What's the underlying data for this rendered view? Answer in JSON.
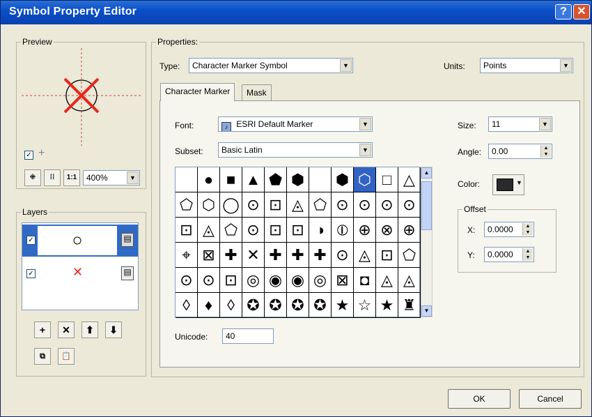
{
  "window": {
    "title": "Symbol Property Editor",
    "help_icon": "question-icon",
    "close_icon": "close-icon"
  },
  "preview": {
    "legend": "Preview",
    "zoom": "400%"
  },
  "layers": {
    "legend": "Layers"
  },
  "properties": {
    "legend": "Properties:",
    "type_label": "Type:",
    "type_value": "Character Marker Symbol",
    "units_label": "Units:",
    "units_value": "Points"
  },
  "tabs": [
    {
      "label": "Character Marker"
    },
    {
      "label": "Mask"
    }
  ],
  "marker": {
    "font_label": "Font:",
    "font_value": "ESRI Default Marker",
    "subset_label": "Subset:",
    "subset_value": "Basic Latin",
    "size_label": "Size:",
    "size_value": "11",
    "angle_label": "Angle:",
    "angle_value": "0.00",
    "color_label": "Color:",
    "color_hex": "#2a2a2a",
    "offset_legend": "Offset",
    "x_label": "X:",
    "x_value": "0.0000",
    "y_label": "Y:",
    "y_value": "0.0000",
    "unicode_label": "Unicode:",
    "unicode_value": "40"
  },
  "glyphs": [
    " ",
    "●",
    "■",
    "▲",
    "⬟",
    "⬢",
    " ",
    "⬢",
    "⬡",
    "□",
    "△",
    "⬠",
    "⬡",
    "◯",
    "⊙",
    "⊡",
    "◬",
    "⬠",
    "⊙",
    "⊙",
    "⊙",
    "⊙",
    "⊡",
    "◬",
    "⬠",
    "⊙",
    "⊡",
    "⊡",
    "◑",
    "⦶",
    "⊕",
    "⊗",
    "⊕",
    "⌖",
    "⊠",
    "✚",
    "✕",
    "✚",
    "✚",
    "✚",
    "⊙",
    "◬",
    "⊡",
    "⬠",
    "⊙",
    "⊙",
    "⊡",
    "◎",
    "◉",
    "◉",
    "◎",
    "⊠",
    "◘",
    "◬",
    "◬",
    "◊",
    "♦",
    "◊",
    "✪",
    "✪",
    "✪",
    "✪",
    "★",
    "☆",
    "★",
    "♜"
  ],
  "selected_glyph_index": 8,
  "buttons": {
    "ok": "OK",
    "cancel": "Cancel"
  }
}
